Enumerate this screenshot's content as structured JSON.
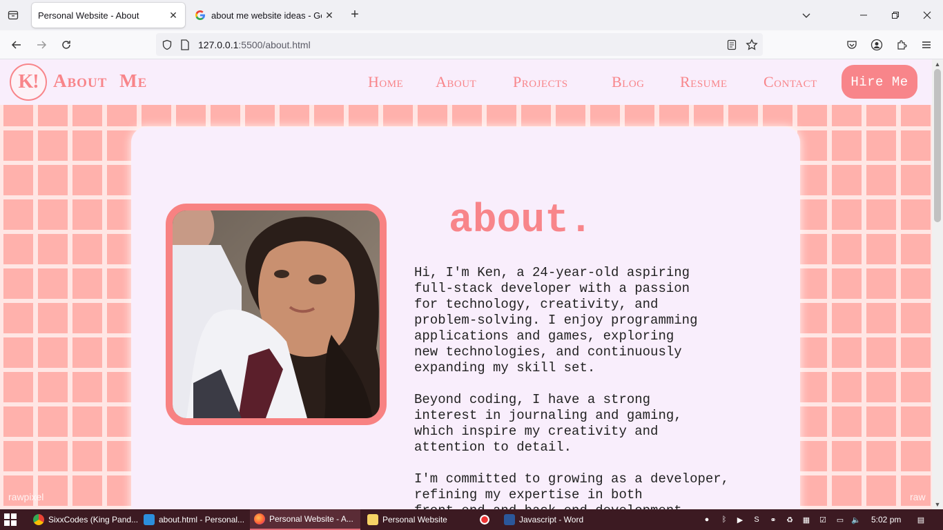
{
  "browser": {
    "tabs": [
      {
        "title": "Personal Website - About",
        "active": true
      },
      {
        "title": "about me website ideas - Goog",
        "active": false
      }
    ],
    "url_host": "127.0.0.1",
    "url_rest": ":5500/about.html"
  },
  "site": {
    "logo_text": "K!",
    "title": "About Me",
    "nav": [
      "Home",
      "About",
      "Projects",
      "Blog",
      "Resume",
      "Contact"
    ],
    "hire_label": "Hire Me",
    "watermark": "rawpixel",
    "watermark_right": "raw"
  },
  "about": {
    "heading": "about.",
    "paragraphs": [
      "  Hi, I'm Ken, a 24-year-old aspiring\nfull-stack developer with a passion\nfor technology, creativity, and\nproblem-solving. I enjoy programming\napplications and games, exploring\nnew technologies, and continuously\nexpanding my skill set.",
      "  Beyond coding, I have a strong\ninterest in journaling and gaming,\nwhich inspire my creativity and\nattention to detail.",
      "  I'm committed to growing as a developer,\nrefining my expertise in both\nfront-end and back-end development."
    ]
  },
  "taskbar": {
    "items": [
      {
        "label": "SixxCodes (King Pand...",
        "active": false
      },
      {
        "label": "about.html - Personal...",
        "active": false
      },
      {
        "label": "Personal Website - A...",
        "active": true
      },
      {
        "label": "Personal Website",
        "active": false
      },
      {
        "label": "",
        "active": false
      },
      {
        "label": "Javascript - Word",
        "active": false
      }
    ],
    "clock": "5:02 pm"
  },
  "colors": {
    "accent": "#f8858a",
    "page_bg": "#f9eefc",
    "grid_cell": "#ffc4c1",
    "taskbar": "#3c1a22"
  }
}
